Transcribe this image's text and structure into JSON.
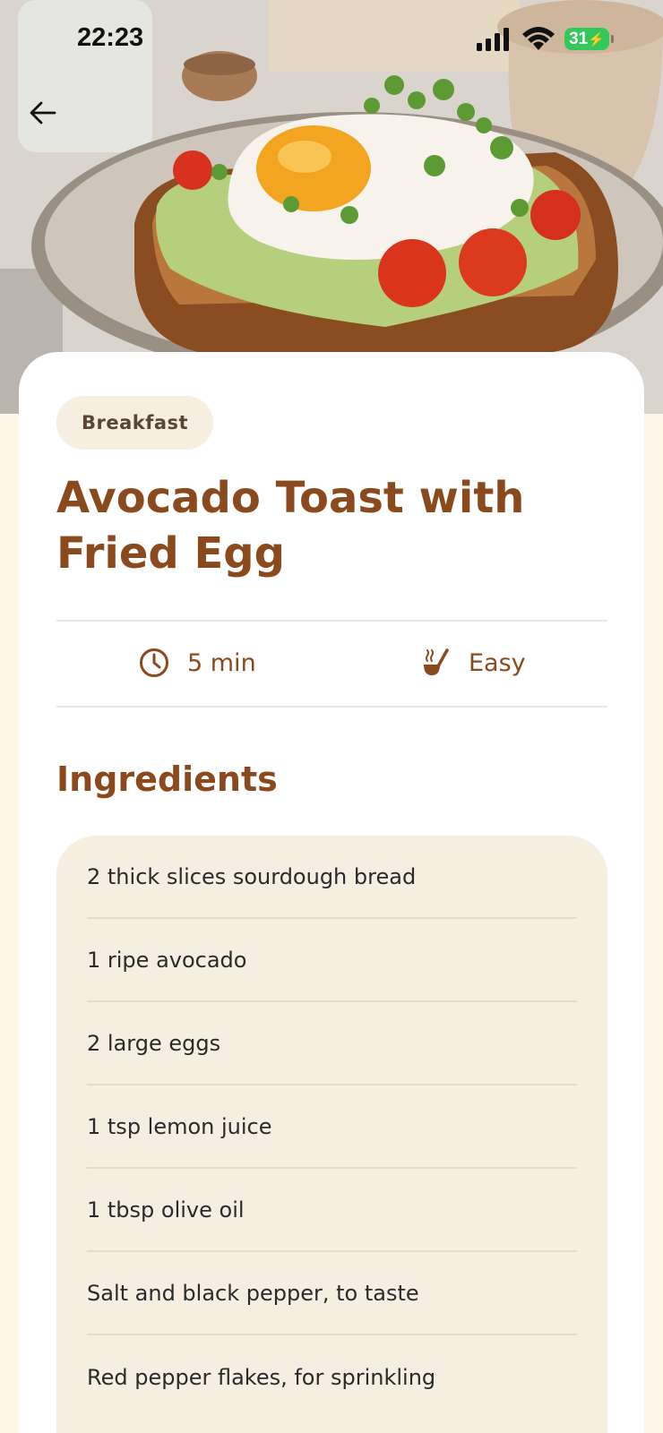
{
  "status_bar": {
    "time": "22:23",
    "battery": "31",
    "icons": [
      "signal-icon",
      "wifi-icon",
      "battery-charging-icon"
    ]
  },
  "header": {
    "back_icon": "arrow-left-icon"
  },
  "recipe": {
    "category": "Breakfast",
    "title": "Avocado Toast with Fried Egg",
    "time": "5 min",
    "difficulty": "Easy",
    "time_icon": "clock-icon",
    "difficulty_icon": "ladle-icon"
  },
  "ingredients": {
    "heading": "Ingredients",
    "items": [
      "2 thick slices sourdough bread",
      "1 ripe avocado",
      "2 large eggs",
      "1 tsp lemon juice",
      "1 tbsp olive oil",
      "Salt and black pepper, to taste",
      "Red pepper flakes, for sprinkling"
    ]
  },
  "colors": {
    "accent": "#8b4a1e",
    "page_bg": "#fdf5e6",
    "chip_bg": "#f5eee1",
    "card_bg": "#ffffff",
    "battery_green": "#34c759"
  }
}
